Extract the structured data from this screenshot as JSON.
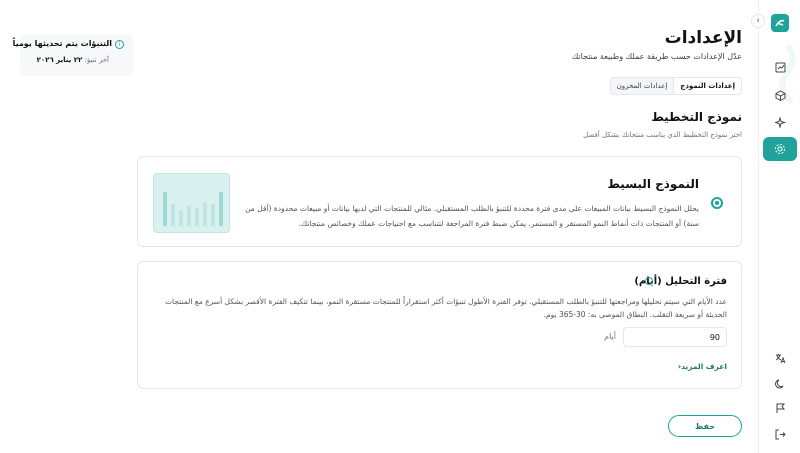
{
  "notice": {
    "title": "التنبؤات يتم تحديثها يومياً",
    "updated_label": "آخر تنبؤ:",
    "updated_date": "٢٢ يناير ٢٠٢٦"
  },
  "header": {
    "title": "الإعدادات",
    "subtitle": "عدّل الإعدادات حسب طريقة عملك وطبيعة منتجاتك"
  },
  "tabs": [
    {
      "label": "إعدادات النموذج",
      "active": true
    },
    {
      "label": "إعدادات المخزون",
      "active": false
    }
  ],
  "model_section": {
    "title": "نموذج التخطيط",
    "description": "اختر نموذج التخطيط الذي يناسب منتجاتك بشكل أفضل",
    "option": {
      "name": "النموذج البسيط",
      "description": "يحلل النموذج البسيط بيانات المبيعات على مدى فترة محددة للتنبؤ بالطلب المستقبلي. مثالي للمنتجات التي لديها بيانات أو مبيعات محدودة (أقل من سنة) أو المنتجات ذات أنماط النمو المستقر و المستمر. يمكن ضبط فترة المراجعة لتتناسب مع احتياجات عملك وخصائص منتجاتك.",
      "selected": true
    }
  },
  "analysis": {
    "title": "فترة التحليل (أيام)",
    "description": "عدد الأيام التي سيتم تحليلها ومراجعتها للتنبؤ بالطلب المستقبلي. توفر الفترة الأطول تنبؤات أكثر استقراراً للمنتجات مستقرة النمو، بينما تتكيف الفترة الأقصر بشكل أسرع مع المنتجات الحديثة أو سريعة التقلب. النطاق الموصى به: 30-365 يوم.",
    "input_value": "90",
    "input_label": "أيام",
    "learn_more": "اعرف المزيد"
  },
  "save_label": "حفظ",
  "colors": {
    "accent": "#1fa39a",
    "thumb_bg": "#d8f1ef"
  },
  "rail_icons": [
    "logo-icon",
    "chart-icon",
    "box-icon",
    "sparkle-icon",
    "settings-icon",
    "translate-icon",
    "moon-icon",
    "flag-icon",
    "logout-icon"
  ]
}
